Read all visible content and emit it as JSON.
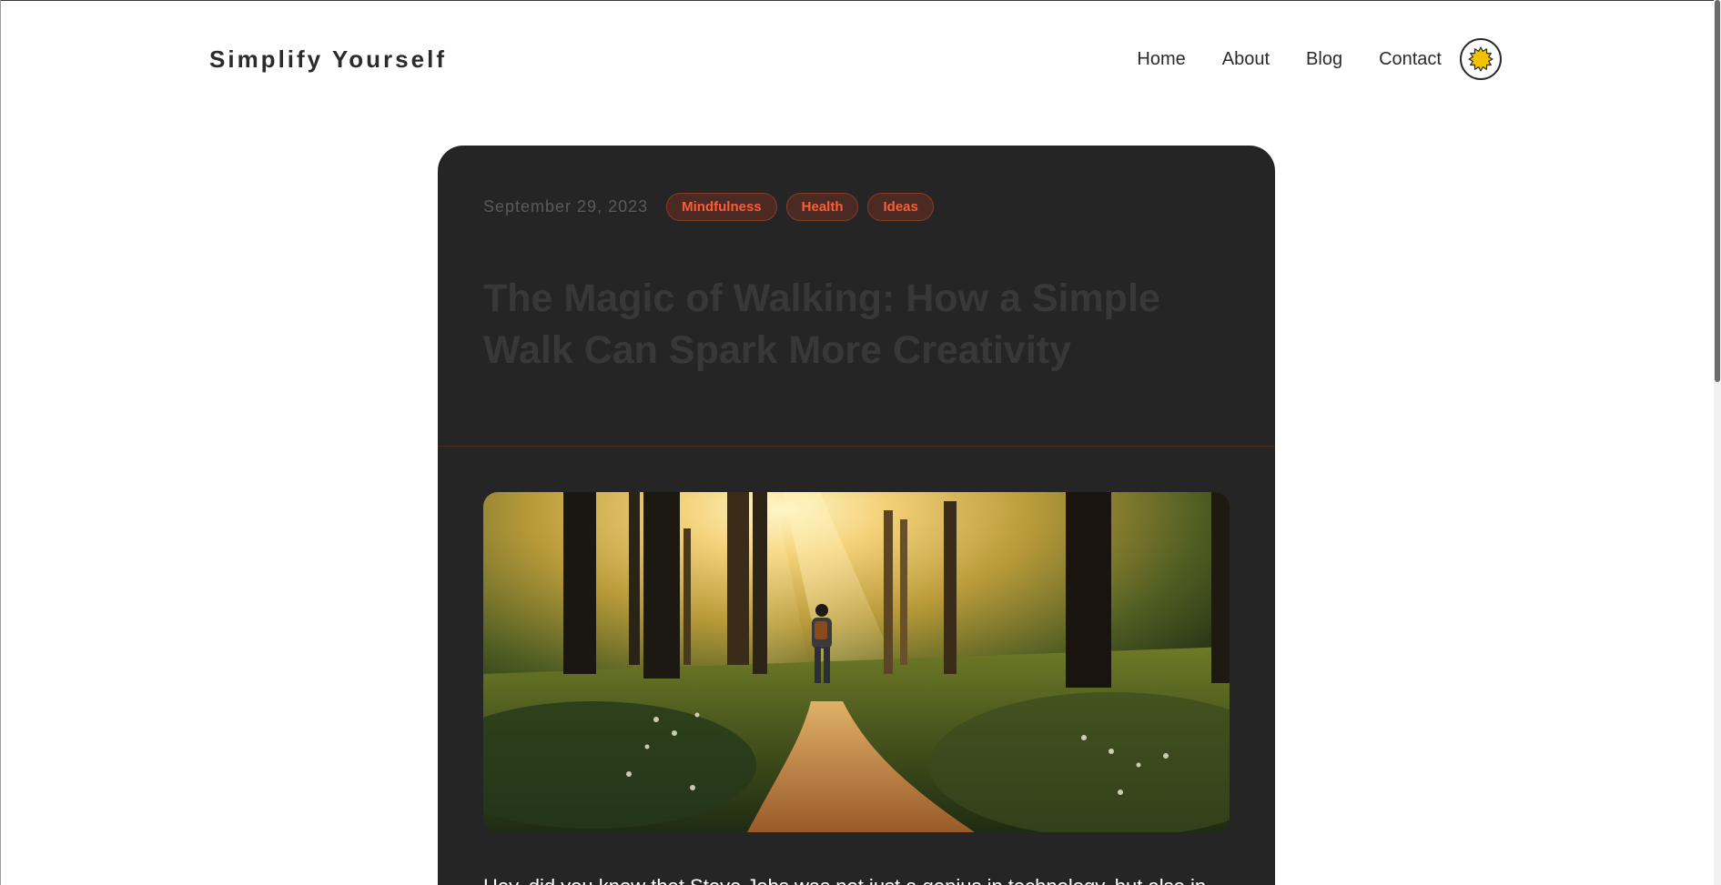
{
  "header": {
    "logo": "Simplify Yourself",
    "nav": [
      {
        "label": "Home"
      },
      {
        "label": "About"
      },
      {
        "label": "Blog"
      },
      {
        "label": "Contact"
      }
    ],
    "theme_toggle_icon": "sun-icon"
  },
  "post": {
    "date": "September 29, 2023",
    "tags": [
      "Mindfulness",
      "Health",
      "Ideas"
    ],
    "title": "The Magic of Walking: How a Simple Walk Can Spark More Creativity",
    "hero_icon": "forest-path-walker-image",
    "excerpt": "Hey, did you know that Steve Jobs was not just a genius in technology, but also in"
  },
  "colors": {
    "accent": "#ff5c35",
    "card_background": "#252525",
    "tag_background": "#4a2a22",
    "sun": "#f2c200"
  }
}
